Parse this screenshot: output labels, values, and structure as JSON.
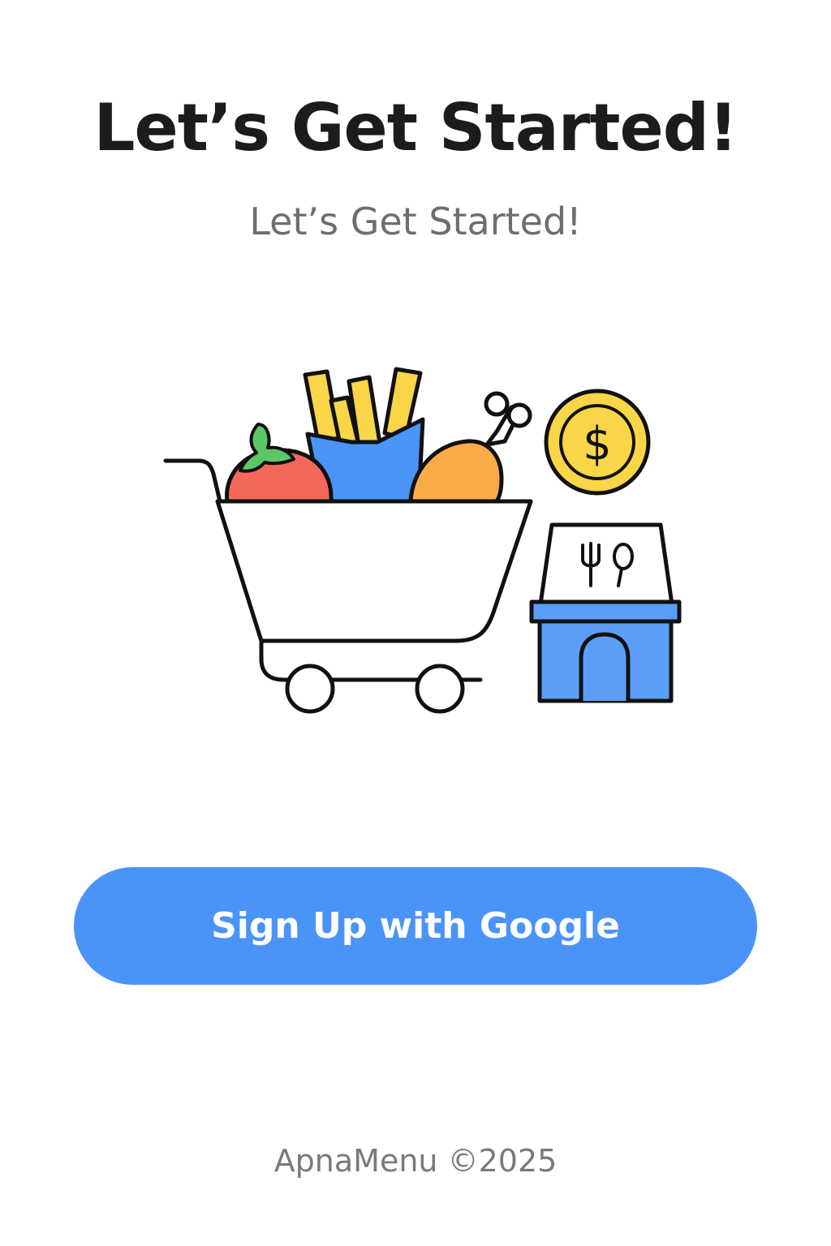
{
  "header": {
    "title": "Let’s Get Started!",
    "subtitle": "Let’s Get Started!"
  },
  "illustration": {
    "icons": [
      "shopping-cart-icon",
      "tomato-icon",
      "fries-icon",
      "chicken-leg-icon",
      "dollar-coin-icon",
      "restaurant-icon"
    ],
    "coin_symbol": "$"
  },
  "actions": {
    "signup_label": "Sign Up with Google"
  },
  "footer": {
    "copyright": "ApnaMenu ©2025"
  },
  "colors": {
    "primary": "#4a94f8",
    "title": "#1c1c1c",
    "subtitle": "#6e6e6e",
    "tomato": "#f4685c",
    "fries": "#f9d548",
    "fries_box": "#4a94f8",
    "chicken": "#f9ac48",
    "leaf": "#5cc865",
    "coin": "#f9d548",
    "restaurant": "#5a9ef8"
  }
}
